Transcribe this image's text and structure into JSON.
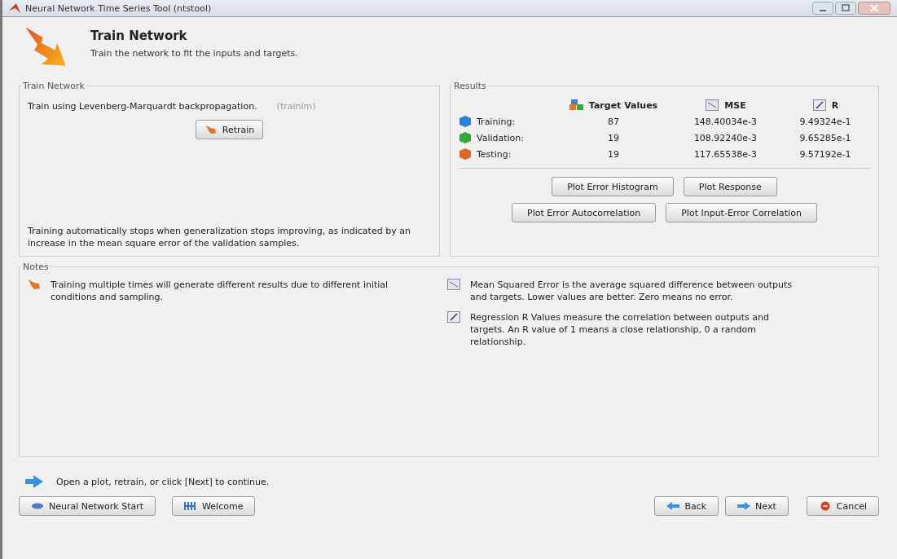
{
  "window": {
    "title": "Neural Network Time Series Tool (ntstool)"
  },
  "header": {
    "title": "Train Network",
    "subtitle": "Train the network to fit the inputs and targets."
  },
  "train_panel": {
    "title": "Train Network",
    "method": "Train using Levenberg-Marquardt backpropagation.",
    "method_code": "(trainlm)",
    "retrain_button": "Retrain",
    "note": "Training automatically stops when generalization stops improving, as indicated by an increase in the mean square error of the validation samples."
  },
  "results": {
    "title": "Results",
    "columns": [
      "Target Values",
      "MSE",
      "R"
    ],
    "rows": [
      {
        "label": "Training:",
        "color": "#2f7fd6",
        "target_values": "87",
        "mse": "148.40034e-3",
        "r": "9.49324e-1"
      },
      {
        "label": "Validation:",
        "color": "#3aa53a",
        "target_values": "19",
        "mse": "108.92240e-3",
        "r": "9.65285e-1"
      },
      {
        "label": "Testing:",
        "color": "#d8692a",
        "target_values": "19",
        "mse": "117.65538e-3",
        "r": "9.57192e-1"
      }
    ],
    "buttons": [
      [
        "Plot Error Histogram",
        "Plot Response"
      ],
      [
        "Plot Error Autocorrelation",
        "Plot Input-Error Correlation"
      ]
    ]
  },
  "notes": {
    "title": "Notes",
    "left": "Training multiple times will generate different results due to different initial conditions and sampling.",
    "mse_note": "Mean Squared Error is the average squared difference between outputs and targets. Lower values are better. Zero means no error.",
    "r_note": "Regression R Values measure the correlation between outputs and targets. An R value of 1 means a close relationship, 0 a random relationship."
  },
  "hint": "Open a plot, retrain, or click [Next] to continue.",
  "footer": {
    "left_buttons": [
      "Neural Network Start",
      "Welcome"
    ],
    "right_buttons": [
      "Back",
      "Next",
      "Cancel"
    ]
  }
}
